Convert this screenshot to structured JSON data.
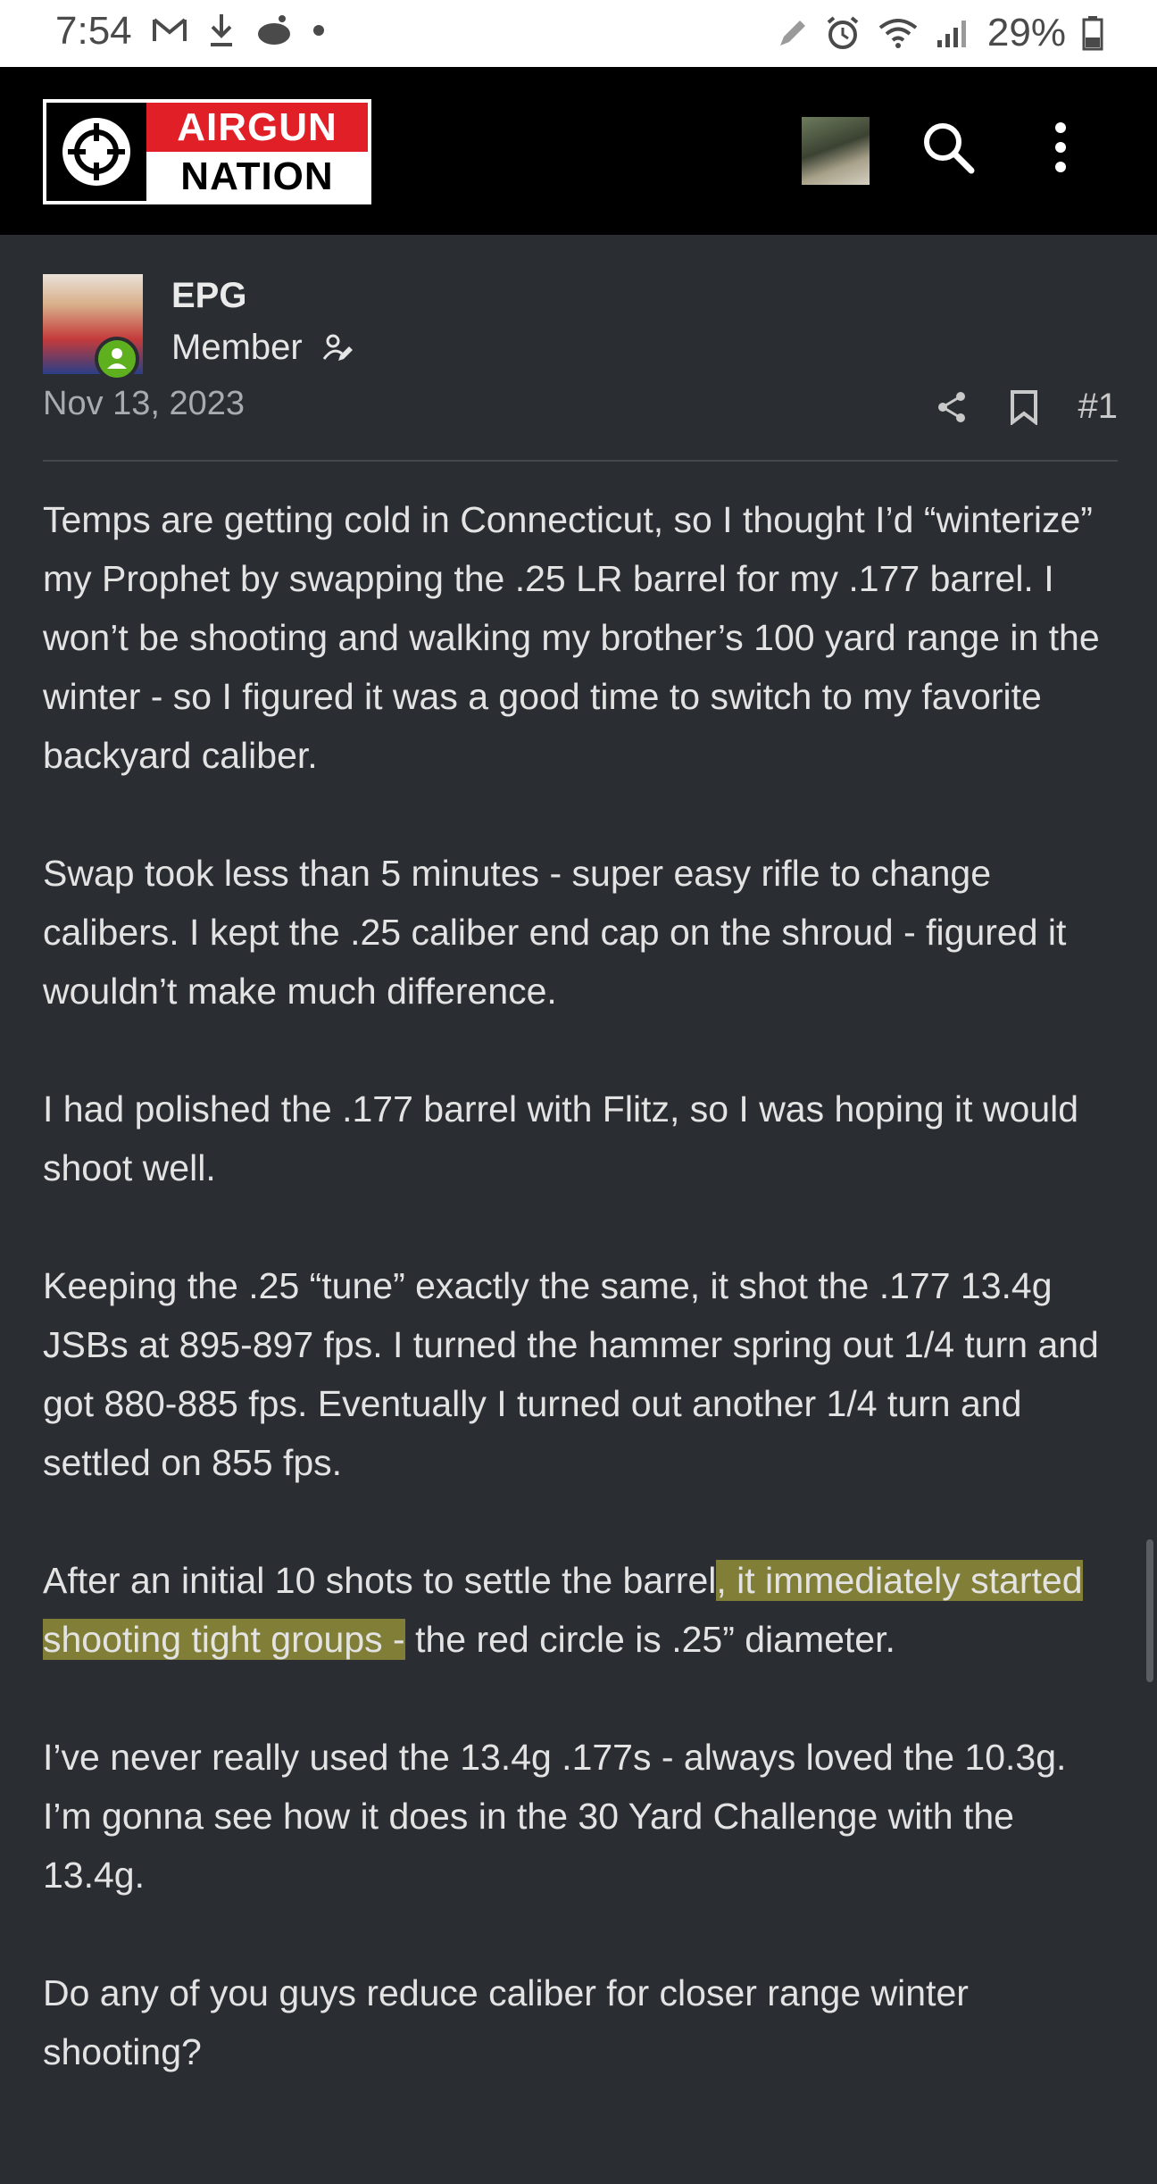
{
  "status_bar": {
    "time": "7:54",
    "battery": "29%",
    "left_icons": [
      "gmail-icon",
      "download-icon",
      "reddit-icon",
      "dot-icon"
    ],
    "right_icons": [
      "pen-icon",
      "alarm-icon",
      "wifi-icon",
      "signal-icon",
      "battery-icon"
    ]
  },
  "header": {
    "logo_line1": "AIRGUN",
    "logo_line2": "NATION"
  },
  "post": {
    "author": "EPG",
    "role": "Member",
    "date": "Nov 13, 2023",
    "number": "#1",
    "paragraphs": [
      "Temps are getting cold in Connecticut, so I thought I’d “winterize” my Prophet by swapping the .25 LR barrel for my .177 barrel. I won’t be shooting and walking my brother’s 100 yard range in the winter - so I figured it was a good time to switch to my favorite backyard caliber.",
      "Swap took less than 5 minutes - super easy rifle to change calibers. I kept the .25 caliber end cap on the shroud - figured it wouldn’t make much difference.",
      "I had polished the .177 barrel with Flitz, so I was hoping it would shoot well.",
      "Keeping the .25 “tune” exactly the same, it shot the .177 13.4g JSBs at 895-897 fps. I turned the hammer spring out 1/4 turn and got 880-885 fps. Eventually I turned out another 1/4 turn and settled on 855 fps."
    ],
    "p5_before": "After an initial 10 shots to settle the barrel",
    "p5_highlight": ", it immediately started shooting tight groups -",
    "p5_after": " the red circle is .25” diameter.",
    "paragraphs_end": [
      "I’ve never really used the 13.4g .177s - always loved the 10.3g. I’m gonna see how it does in the 30 Yard Challenge with the 13.4g.",
      "Do any of you guys reduce caliber for closer range winter shooting?"
    ]
  },
  "colors": {
    "background": "#2a2d32",
    "header": "#000000",
    "logo_red": "#e01f26",
    "online_green": "#5fb01f",
    "highlight": "#c8c33c"
  }
}
